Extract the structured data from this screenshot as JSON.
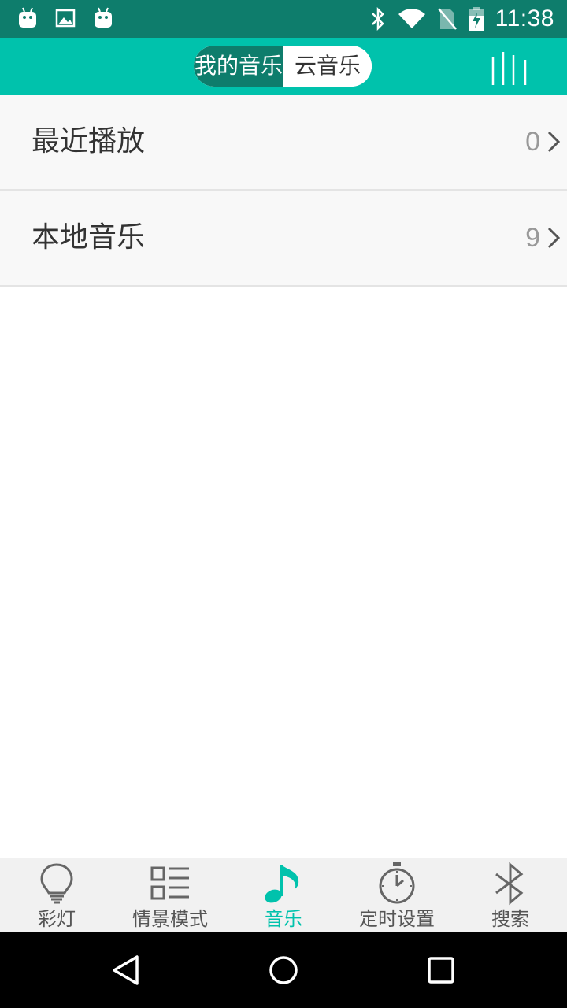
{
  "status_bar": {
    "time": "11:38",
    "icons_left": [
      "android-icon",
      "image-icon",
      "android-icon"
    ],
    "icons_right": [
      "bluetooth-icon",
      "wifi-icon",
      "no-sim-icon",
      "battery-charging-icon"
    ]
  },
  "header": {
    "tabs": [
      {
        "label": "我的音乐",
        "active": true
      },
      {
        "label": "云音乐",
        "active": false
      }
    ],
    "menu_icon": "equalizer-bars-icon"
  },
  "list": {
    "items": [
      {
        "label": "最近播放",
        "count": "0",
        "icon": "chevron-right-icon"
      },
      {
        "label": "本地音乐",
        "count": "9",
        "icon": "chevron-right-icon"
      }
    ]
  },
  "bottom_nav": {
    "items": [
      {
        "label": "彩灯",
        "icon": "lightbulb-icon",
        "active": false
      },
      {
        "label": "情景模式",
        "icon": "list-icon",
        "active": false
      },
      {
        "label": "音乐",
        "icon": "music-note-icon",
        "active": true
      },
      {
        "label": "定时设置",
        "icon": "stopwatch-icon",
        "active": false
      },
      {
        "label": "搜索",
        "icon": "bluetooth-icon",
        "active": false
      }
    ]
  },
  "system_nav": {
    "buttons": [
      "back-icon",
      "home-icon",
      "recents-icon"
    ]
  },
  "colors": {
    "status_bar": "#0e7d6c",
    "header": "#00c2ac",
    "accent": "#00c2ac",
    "active_tab": "#0e7d6c",
    "bottom_nav_bg": "#f1f1f1",
    "list_bg": "#f8f8f8"
  }
}
